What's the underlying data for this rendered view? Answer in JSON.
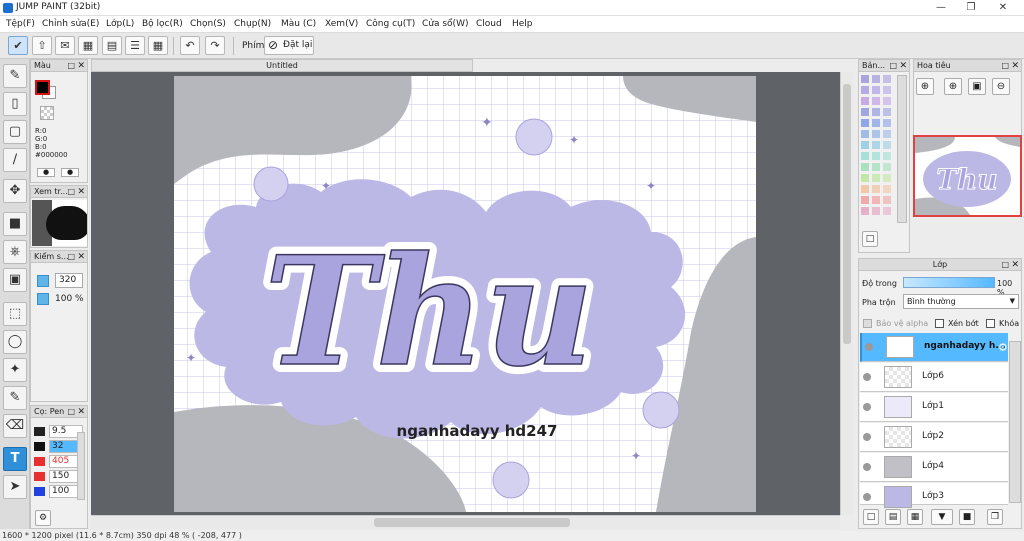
{
  "window": {
    "title": "JUMP PAINT (32bit)"
  },
  "menu": [
    "Tệp(F)",
    "Chỉnh sửa(E)",
    "Lớp(L)",
    "Bộ lọc(R)",
    "Chọn(S)",
    "Chụp(N)",
    "Màu (C)",
    "Xem(V)",
    "Công cụ(T)",
    "Cửa sổ(W)",
    "Cloud",
    "Help"
  ],
  "toolbar": {
    "shortcut_label": "Phím",
    "reset_label": "Đặt lại"
  },
  "document": {
    "tab_title": "Untitled",
    "canvas_title": "Thu",
    "canvas_subtitle": "nganhadayy hd247"
  },
  "color_panel": {
    "title": "Màu",
    "r": "R:0",
    "g": "G:0",
    "b": "B:0",
    "hex": "#000000",
    "primary": "#000000",
    "secondary": "#ffffff"
  },
  "preview_panel": {
    "title": "Xem tr..."
  },
  "check_panel": {
    "title": "Kiểm s...",
    "size": "320",
    "opacity": "100 %"
  },
  "brush_panel": {
    "title": "Cọ: Pen",
    "sizes": [
      {
        "value": "9.5",
        "color": "#222222"
      },
      {
        "value": "32",
        "color": "#111111"
      },
      {
        "value": "405",
        "color": "#e83030"
      },
      {
        "value": "150",
        "color": "#e83030"
      },
      {
        "value": "100",
        "color": "#2040e0"
      }
    ]
  },
  "swatch_panel": {
    "title": "Bản..."
  },
  "navigator": {
    "title": "Hoa tiêu"
  },
  "layers_panel": {
    "title": "Lớp",
    "opacity_label": "Độ trong",
    "opacity_value": "100 %",
    "blend_label": "Pha trộn",
    "blend_value": "Bình thường",
    "protect_alpha": "Bảo vệ alpha",
    "clip": "Xén bớt",
    "lock": "Khóa",
    "layers": [
      "nganhadayy h...",
      "Lớp6",
      "Lớp1",
      "Lớp2",
      "Lớp4",
      "Lớp3"
    ]
  },
  "status": {
    "text": "1600 * 1200 pixel   (11.6 * 8.7cm)   350 dpi   48 %   ( -208, 477 )"
  },
  "colors": {
    "accent": "#54b9ff",
    "selected_tool": "#2f8fd9",
    "lavender": "#a9a3de",
    "canvas_bg": "#5f6266"
  }
}
